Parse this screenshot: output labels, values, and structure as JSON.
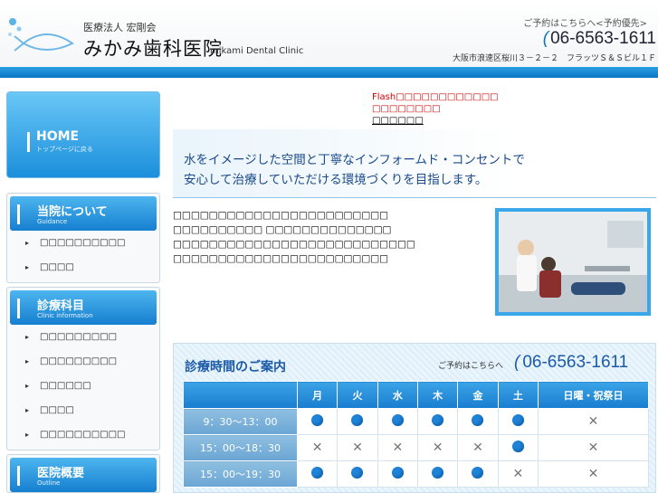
{
  "header": {
    "org": "医療法人 宏剛会",
    "clinic_name": "みかみ歯科医院",
    "clinic_en": "mikami Dental Clinic",
    "reservation_note": "ご予約はこちらへ<予約優先>",
    "phone": "06-6563-1611",
    "address": "大阪市浪速区桜川３－２－２　フラッツＳ＆Ｓビル１Ｆ"
  },
  "sidebar": {
    "home": {
      "label": "HOME",
      "sub": "トップページに戻る"
    },
    "sections": [
      {
        "title": "当院について",
        "sub": "Guidance",
        "items": [
          "□□□□□□□□□□",
          "□□□□"
        ]
      },
      {
        "title": "診療科目",
        "sub": "Clinic information",
        "items": [
          "□□□□□□□□□",
          "□□□□□□□□□",
          "□□□□□□",
          "□□□□",
          "□□□□□□□□□□"
        ]
      },
      {
        "title": "医院概要",
        "sub": "Outline",
        "items": []
      }
    ]
  },
  "flash": {
    "line1": "Flash□□□□□□□□□□□□",
    "line2": "□□□□□□□□",
    "line3": "□□□□□□"
  },
  "slogan": {
    "line1": "水をイメージした空間と丁寧なインフォームド・コンセントで",
    "line2": "安心して治療していただける環境づくりを目指します。"
  },
  "intro": [
    "□□□□□□□□□□□□□□□□□□□□□□□□",
    "□□□□□□□□□□ □□□□□□□□□□□□□□",
    "□□□□□□□□□□□□□□□□□□□□□□□□□□□",
    "□□□□□□□□□□□□□□□□□□□□□□□□"
  ],
  "hours": {
    "title": "診療時間のご案内",
    "reservation_note": "ご予約はこちらへ",
    "phone": "06-6563-1611",
    "days": [
      "月",
      "火",
      "水",
      "木",
      "金",
      "土",
      "日曜・祝祭日"
    ],
    "rows": [
      {
        "time": "9：30～13：00",
        "open": [
          true,
          true,
          true,
          true,
          true,
          true,
          false
        ]
      },
      {
        "time": "15：00～18：30",
        "open": [
          false,
          false,
          false,
          false,
          false,
          true,
          false
        ]
      },
      {
        "time": "15：00～19：30",
        "open": [
          true,
          true,
          true,
          true,
          true,
          false,
          false
        ]
      }
    ]
  },
  "icons": {
    "phone": "phone-icon",
    "fish_logo": "fish-logo-icon",
    "arrow": "arrow-right-icon"
  },
  "colors": {
    "accent": "#1a7dd0",
    "brand_light": "#3aa7ea",
    "flash_text": "#d00000"
  }
}
